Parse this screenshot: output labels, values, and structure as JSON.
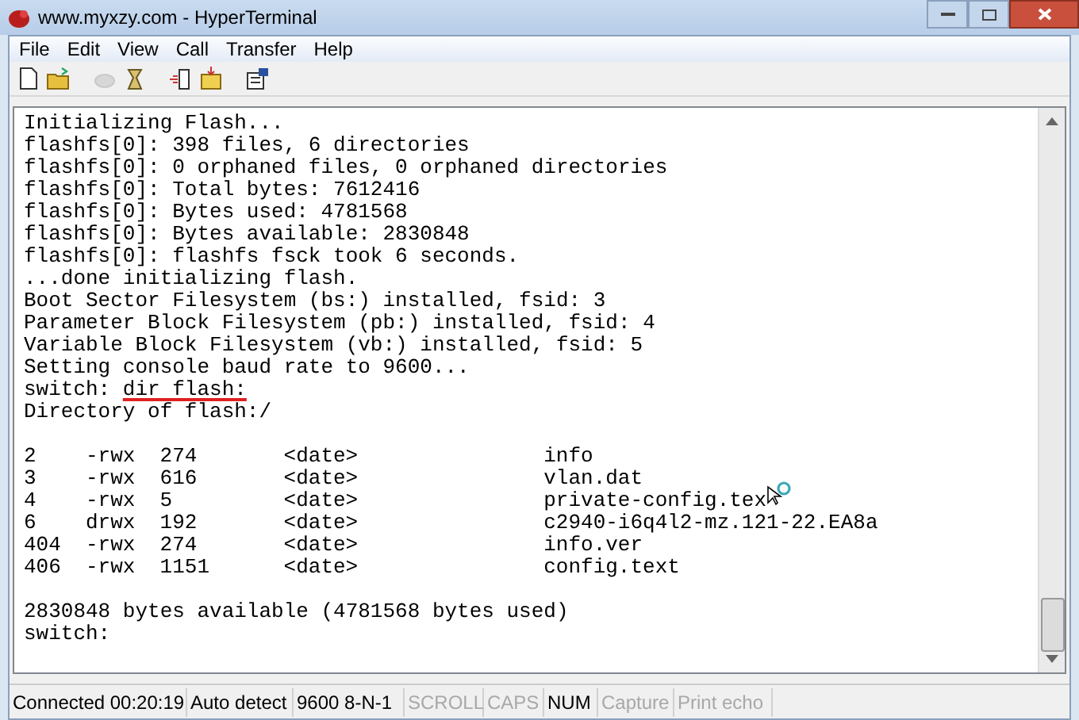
{
  "window": {
    "title": "www.myxzy.com - HyperTerminal"
  },
  "menu": [
    "File",
    "Edit",
    "View",
    "Call",
    "Transfer",
    "Help"
  ],
  "toolbar": [
    {
      "kind": "new",
      "disabled": false
    },
    {
      "kind": "open",
      "disabled": false
    },
    {
      "kind": "call",
      "disabled": true
    },
    {
      "kind": "hangup",
      "disabled": false
    },
    {
      "kind": "send",
      "disabled": false
    },
    {
      "kind": "receive",
      "disabled": false
    },
    {
      "kind": "properties",
      "disabled": false
    }
  ],
  "terminal": {
    "lines": [
      {
        "kind": "text",
        "text": "Initializing Flash..."
      },
      {
        "kind": "text",
        "text": "flashfs[0]: 398 files, 6 directories"
      },
      {
        "kind": "text",
        "text": "flashfs[0]: 0 orphaned files, 0 orphaned directories"
      },
      {
        "kind": "text",
        "text": "flashfs[0]: Total bytes: 7612416"
      },
      {
        "kind": "text",
        "text": "flashfs[0]: Bytes used: 4781568"
      },
      {
        "kind": "text",
        "text": "flashfs[0]: Bytes available: 2830848"
      },
      {
        "kind": "text",
        "text": "flashfs[0]: flashfs fsck took 6 seconds."
      },
      {
        "kind": "text",
        "text": "...done initializing flash."
      },
      {
        "kind": "text",
        "text": "Boot Sector Filesystem (bs:) installed, fsid: 3"
      },
      {
        "kind": "text",
        "text": "Parameter Block Filesystem (pb:) installed, fsid: 4"
      },
      {
        "kind": "text",
        "text": "Variable Block Filesystem (vb:) installed, fsid: 5"
      },
      {
        "kind": "text",
        "text": "Setting console baud rate to 9600..."
      },
      {
        "kind": "prompt",
        "prompt": "switch:",
        "command": "dir flash:",
        "underlined": true
      },
      {
        "kind": "text",
        "text": "Directory of flash:/"
      },
      {
        "kind": "blank"
      },
      {
        "kind": "entry",
        "cells": [
          "2",
          "-rwx",
          "274",
          "<date>",
          "info"
        ]
      },
      {
        "kind": "entry",
        "cells": [
          "3",
          "-rwx",
          "616",
          "<date>",
          "vlan.dat"
        ]
      },
      {
        "kind": "entry",
        "cells": [
          "4",
          "-rwx",
          "5",
          "<date>",
          "private-config.tex"
        ],
        "cursor": true
      },
      {
        "kind": "entry",
        "cells": [
          "6",
          "drwx",
          "192",
          "<date>",
          "c2940-i6q4l2-mz.121-22.EA8a"
        ]
      },
      {
        "kind": "entry",
        "cells": [
          "404",
          "-rwx",
          "274",
          "<date>",
          "info.ver"
        ]
      },
      {
        "kind": "entry",
        "cells": [
          "406",
          "-rwx",
          "1151",
          "<date>",
          "config.text"
        ]
      },
      {
        "kind": "blank"
      },
      {
        "kind": "text",
        "text": "2830848 bytes available (4781568 bytes used)"
      },
      {
        "kind": "text",
        "text": "switch:"
      }
    ]
  },
  "status_bar": [
    {
      "text": "Connected 00:20:19",
      "active": true
    },
    {
      "text": "Auto detect",
      "active": true
    },
    {
      "text": "9600 8-N-1",
      "active": true
    },
    {
      "text": "SCROLL",
      "active": false
    },
    {
      "text": "CAPS",
      "active": false
    },
    {
      "text": "NUM",
      "active": true
    },
    {
      "text": "Capture",
      "active": false
    },
    {
      "text": "Print echo",
      "active": false
    }
  ]
}
